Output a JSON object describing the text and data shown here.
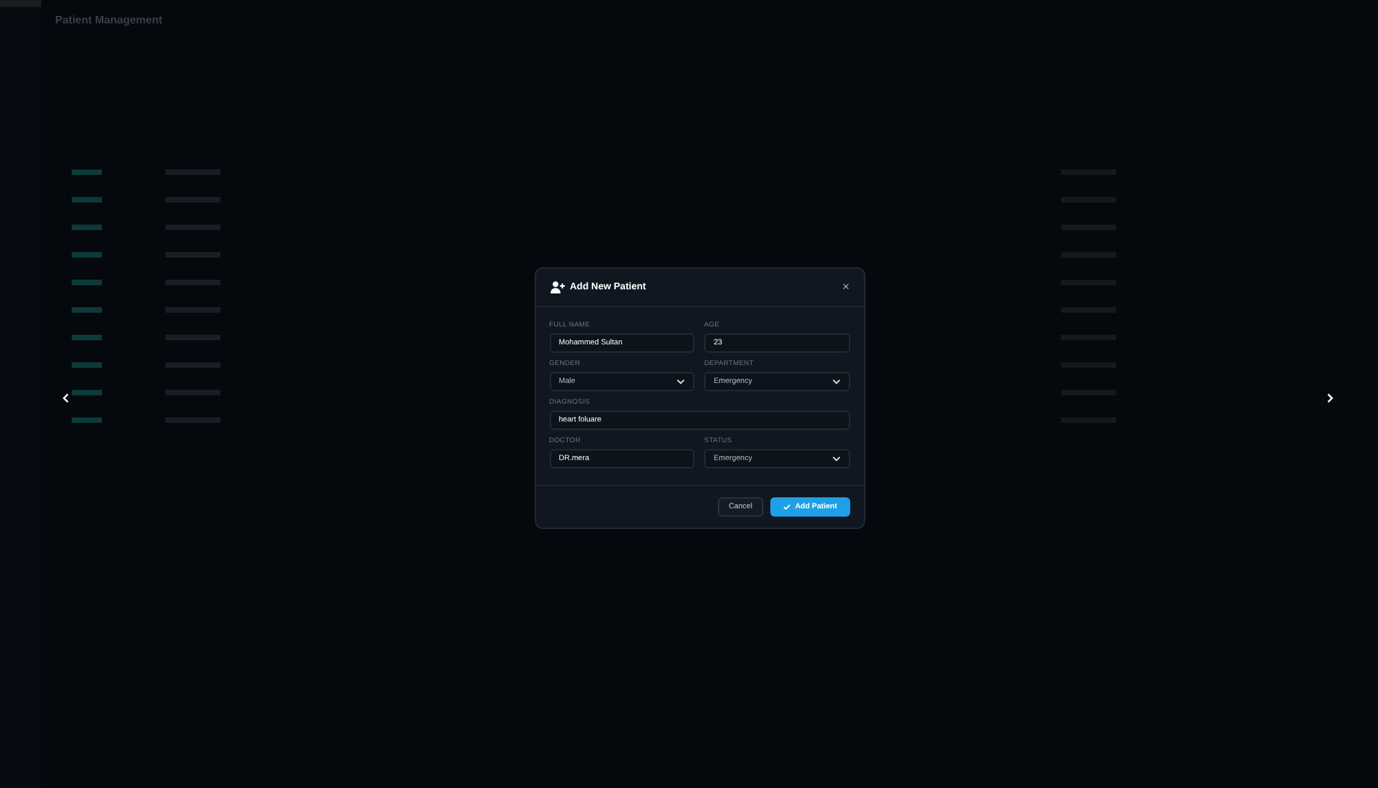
{
  "page": {
    "title": "Patient Management"
  },
  "dialog": {
    "title": "Add New Patient",
    "close": "×",
    "fields": [
      {
        "label": "FULL NAME",
        "kind": "text",
        "value": "Mohammed Sultan",
        "wide": false
      },
      {
        "label": "AGE",
        "kind": "text",
        "value": "23",
        "wide": false
      },
      {
        "label": "GENDER",
        "kind": "select",
        "value": "Male",
        "wide": false
      },
      {
        "label": "DEPARTMENT",
        "kind": "select",
        "value": "Emergency",
        "wide": false
      },
      {
        "label": "DIAGNOSIS",
        "kind": "text",
        "value": "heart foluare",
        "wide": true
      },
      {
        "label": "DOCTOR",
        "kind": "text",
        "value": "DR.mera",
        "wide": false
      },
      {
        "label": "STATUS",
        "kind": "select",
        "value": "Emergency",
        "wide": false
      }
    ],
    "buttons": [
      {
        "label": "Cancel",
        "kind": "secondary"
      },
      {
        "label": "Add Patient",
        "kind": "primary"
      }
    ]
  }
}
